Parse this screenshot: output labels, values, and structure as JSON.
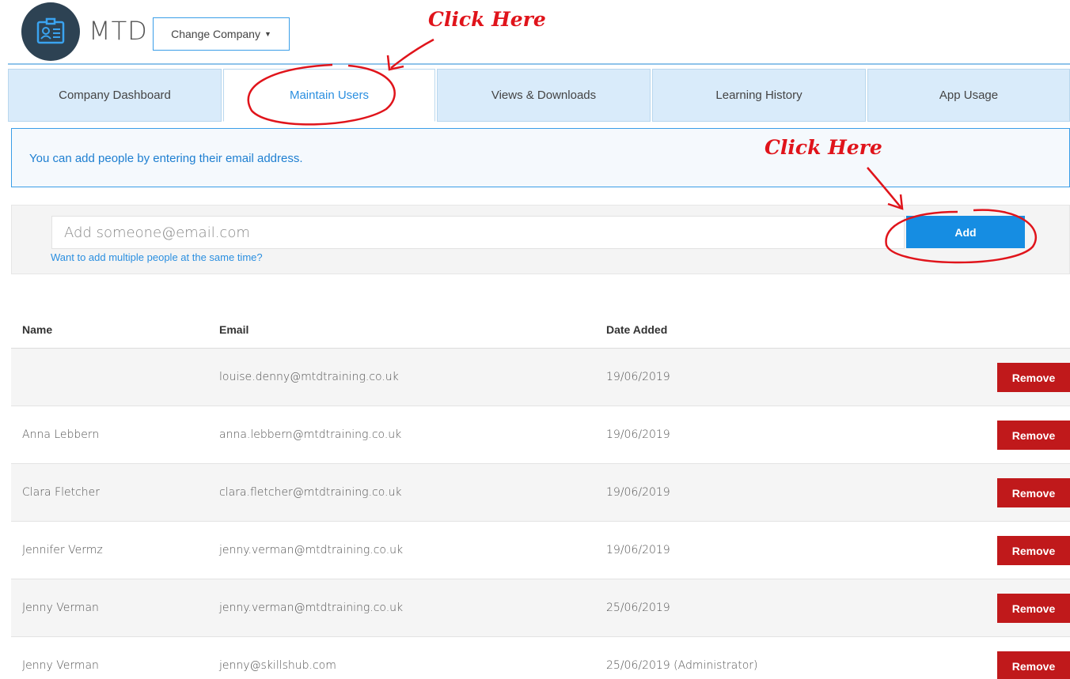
{
  "header": {
    "brand": "MTD",
    "change_company_label": "Change Company",
    "logo_icon": "id-card-icon"
  },
  "tabs": [
    {
      "label": "Company Dashboard",
      "active": false
    },
    {
      "label": "Maintain Users",
      "active": true
    },
    {
      "label": "Views & Downloads",
      "active": false
    },
    {
      "label": "Learning History",
      "active": false
    },
    {
      "label": "App Usage",
      "active": false
    }
  ],
  "info": {
    "message": "You can add people by entering their email address."
  },
  "add_form": {
    "placeholder": "Add someone@email.com",
    "value": "",
    "multiple_link": "Want to add multiple people at the same time?",
    "add_label": "Add"
  },
  "table": {
    "headers": {
      "name": "Name",
      "email": "Email",
      "date": "Date Added"
    },
    "rows": [
      {
        "name": "",
        "email": "louise.denny@mtdtraining.co.uk",
        "date": "19/06/2019",
        "note": "",
        "remove": "Remove"
      },
      {
        "name": "Anna Lebbern",
        "email": "anna.lebbern@mtdtraining.co.uk",
        "date": "19/06/2019",
        "note": "",
        "remove": "Remove"
      },
      {
        "name": "Clara Fletcher",
        "email": "clara.fletcher@mtdtraining.co.uk",
        "date": "19/06/2019",
        "note": "",
        "remove": "Remove"
      },
      {
        "name": "Jennifer Vermz",
        "email": "jenny.verman@mtdtraining.co.uk",
        "date": "19/06/2019",
        "note": "",
        "remove": "Remove"
      },
      {
        "name": "Jenny Verman",
        "email": "jenny.verman@mtdtraining.co.uk",
        "date": "25/06/2019",
        "note": "",
        "remove": "Remove"
      },
      {
        "name": "Jenny Verman",
        "email": "jenny@skillshub.com",
        "date": "25/06/2019",
        "note": " (Administrator)",
        "remove": "Remove"
      }
    ]
  },
  "annotations": {
    "tab_hint": "Click Here",
    "add_hint": "Click Here",
    "color": "#e0141b"
  },
  "colors": {
    "accent": "#168de2",
    "danger": "#c0191b",
    "date": "#5aa84a",
    "tab_bg": "#d9ebfa"
  }
}
